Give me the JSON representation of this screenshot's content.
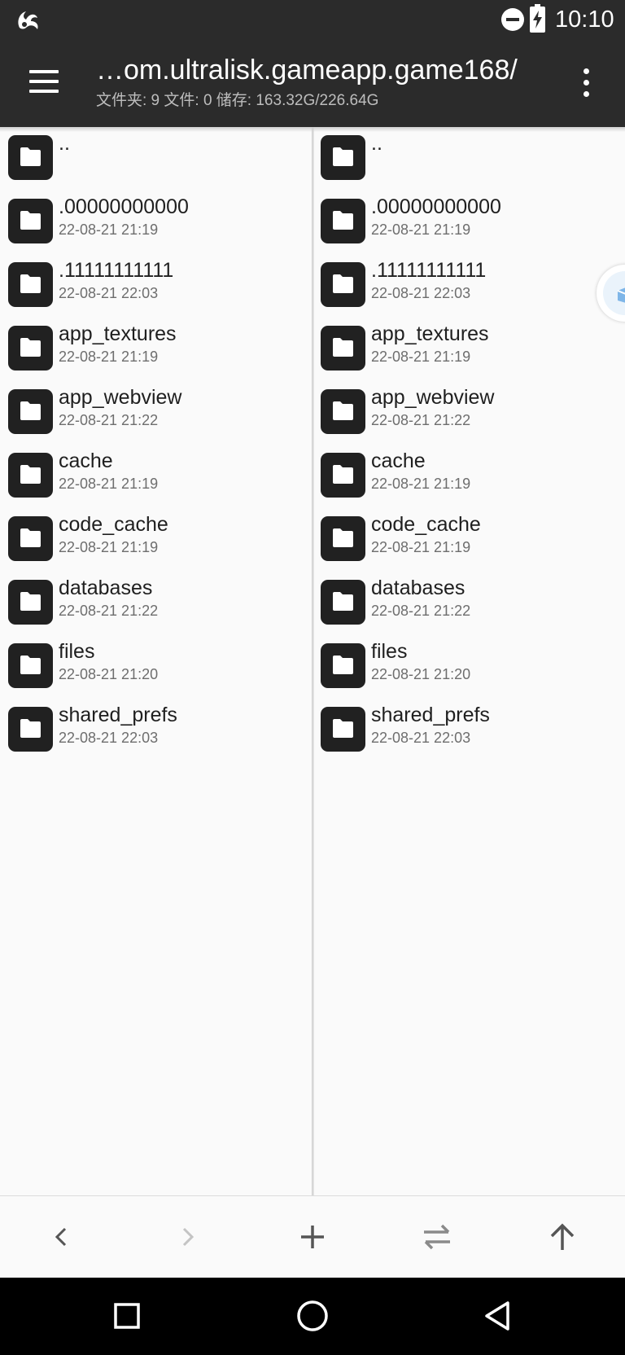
{
  "status_bar": {
    "time": "10:10",
    "icons": [
      "uc-browser-icon",
      "do-not-disturb-icon",
      "battery-charging-icon"
    ]
  },
  "toolbar": {
    "title": "…om.ultralisk.gameapp.game168/",
    "subtitle": "文件夹: 9  文件: 0  储存: 163.32G/226.64G",
    "menu_icon": "hamburger-menu-icon",
    "more_icon": "more-vert-icon"
  },
  "left_pane": {
    "items": [
      {
        "name": "..",
        "date": ""
      },
      {
        "name": ".00000000000",
        "date": "22-08-21 21:19"
      },
      {
        "name": ".11111111111",
        "date": "22-08-21 22:03"
      },
      {
        "name": "app_textures",
        "date": "22-08-21 21:19"
      },
      {
        "name": "app_webview",
        "date": "22-08-21 21:22"
      },
      {
        "name": "cache",
        "date": "22-08-21 21:19"
      },
      {
        "name": "code_cache",
        "date": "22-08-21 21:19"
      },
      {
        "name": "databases",
        "date": "22-08-21 21:22"
      },
      {
        "name": "files",
        "date": "22-08-21 21:20"
      },
      {
        "name": "shared_prefs",
        "date": "22-08-21 22:03"
      }
    ]
  },
  "right_pane": {
    "items": [
      {
        "name": "..",
        "date": ""
      },
      {
        "name": ".00000000000",
        "date": "22-08-21 21:19"
      },
      {
        "name": ".11111111111",
        "date": "22-08-21 22:03"
      },
      {
        "name": "app_textures",
        "date": "22-08-21 21:19"
      },
      {
        "name": "app_webview",
        "date": "22-08-21 21:22"
      },
      {
        "name": "cache",
        "date": "22-08-21 21:19"
      },
      {
        "name": "code_cache",
        "date": "22-08-21 21:19"
      },
      {
        "name": "databases",
        "date": "22-08-21 21:22"
      },
      {
        "name": "files",
        "date": "22-08-21 21:20"
      },
      {
        "name": "shared_prefs",
        "date": "22-08-21 22:03"
      }
    ]
  },
  "action_bar": {
    "buttons": [
      "back-arrow-icon",
      "forward-arrow-icon",
      "add-icon",
      "swap-panes-icon",
      "up-directory-icon"
    ],
    "forward_enabled": false
  },
  "nav_bar": {
    "buttons": [
      "recents-icon",
      "home-icon",
      "back-icon"
    ]
  },
  "colors": {
    "toolbar_bg": "#2b2b2b",
    "pane_bg": "#fafafa",
    "folder_icon_bg": "#212121",
    "date_text": "#6e6e6e"
  }
}
